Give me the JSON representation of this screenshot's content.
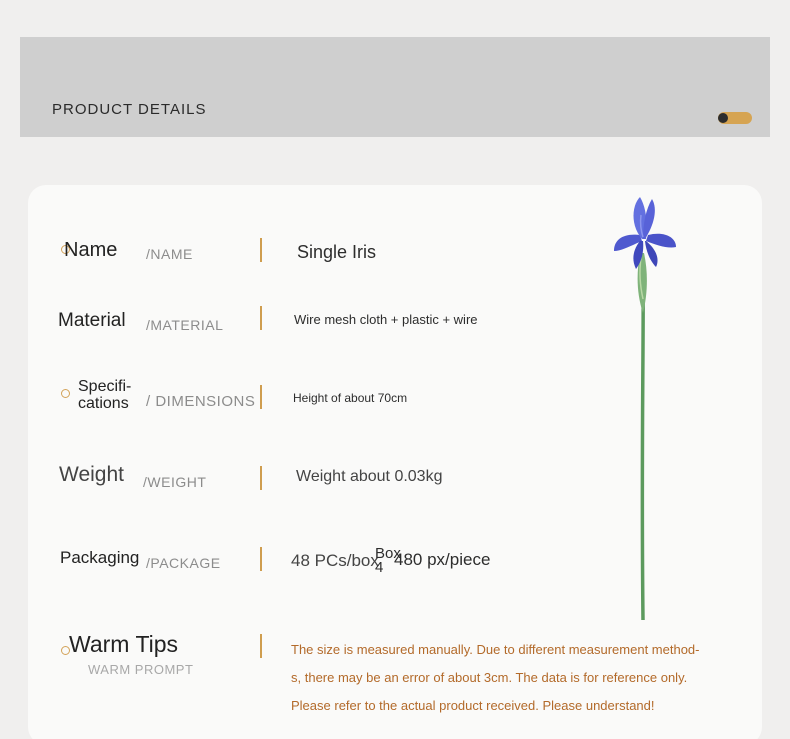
{
  "header": {
    "title": "PRODUCT DETAILS"
  },
  "colors": {
    "accent": "#cf9d4f",
    "tips_text": "#b36a2a",
    "petal": "#5b64d6"
  },
  "rows": {
    "name": {
      "label": "Name",
      "en": "/NAME",
      "value": "Single Iris"
    },
    "material": {
      "label": "Material",
      "en": "/MATERIAL",
      "value": "Wire mesh cloth + plastic + wire"
    },
    "specs": {
      "label_line1": "Specifi-",
      "label_line2": "cations",
      "en": "/ DIMENSIONS",
      "value": "Height of about 70cm"
    },
    "weight": {
      "label": "Weight",
      "en": "/WEIGHT",
      "value": "Weight about 0.03kg"
    },
    "packaging": {
      "label": "Packaging",
      "en": "/PACKAGE",
      "value_a": "48 PCs/box",
      "value_b": "Box",
      "value_c": "4",
      "value_d": "480 px/piece"
    },
    "tips": {
      "label": "Warm Tips",
      "en": "WARM PROMPT",
      "line1": "The size is measured manually. Due to different measurement method-",
      "line2": "s, there may be an error of about 3cm. The data is for reference only.",
      "line3": "Please refer to the actual product received. Please understand!"
    }
  }
}
